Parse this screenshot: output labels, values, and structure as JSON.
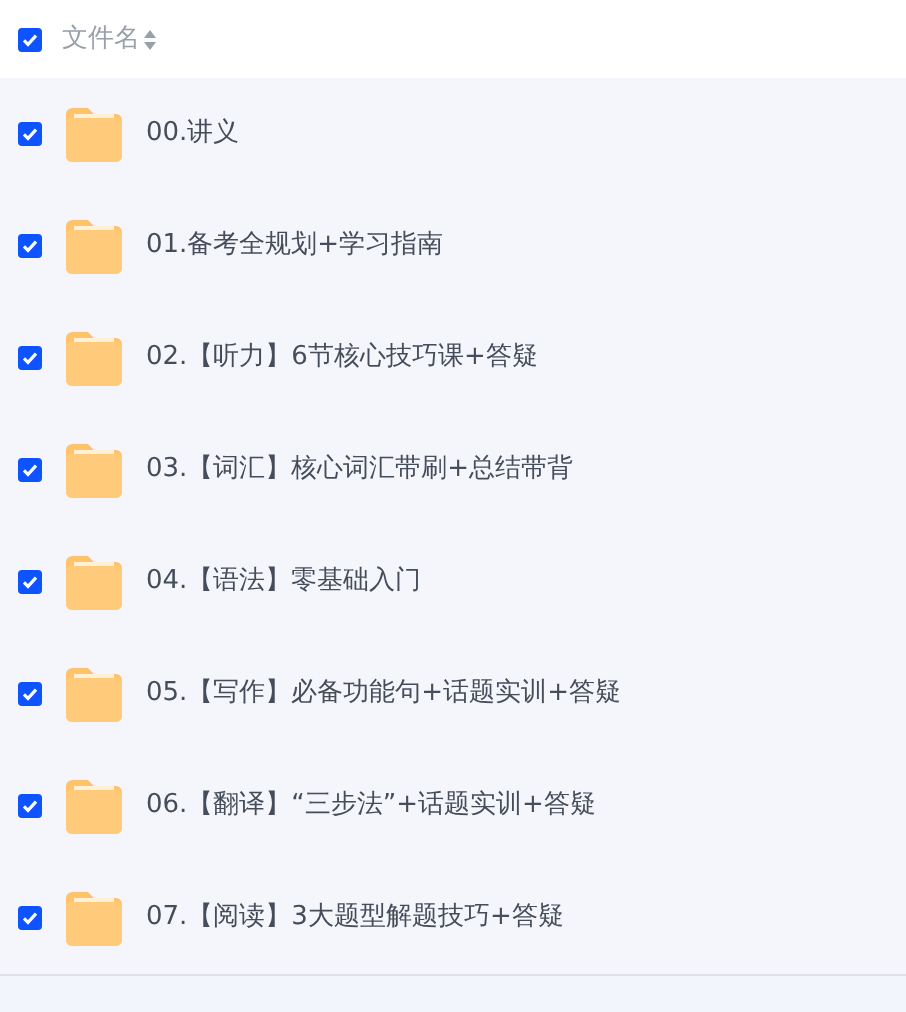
{
  "header": {
    "checked": true,
    "column_label": "文件名"
  },
  "rows": [
    {
      "name": "00.讲义",
      "checked": true
    },
    {
      "name": "01.备考全规划+学习指南",
      "checked": true
    },
    {
      "name": "02.【听力】6节核心技巧课+答疑",
      "checked": true
    },
    {
      "name": "03.【词汇】核心词汇带刷+总结带背",
      "checked": true
    },
    {
      "name": "04.【语法】零基础入门",
      "checked": true
    },
    {
      "name": "05.【写作】必备功能句+话题实训+答疑",
      "checked": true
    },
    {
      "name": "06.【翻译】“三步法”+话题实训+答疑",
      "checked": true
    },
    {
      "name": "07.【阅读】3大题型解题技巧+答疑",
      "checked": true
    }
  ]
}
